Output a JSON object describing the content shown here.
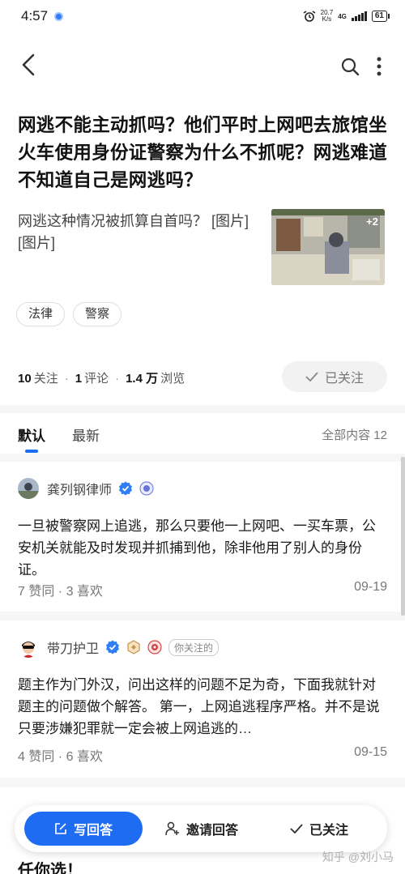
{
  "status_bar": {
    "time": "4:57",
    "speed_value": "20.7",
    "speed_unit": "K/s",
    "network": "4G",
    "battery": "61"
  },
  "question": {
    "title": "网逃不能主动抓吗？他们平时上网吧去旅馆坐火车使用身份证警察为什么不抓呢？网逃难道不知道自己是网逃吗？",
    "detail": "网逃这种情况被抓算自首吗？ [图片] [图片]",
    "image_count": "+2",
    "tags": [
      "法律",
      "警察"
    ],
    "stats": {
      "follow_num": "10",
      "follow_label": "关注",
      "comment_num": "1",
      "comment_label": "评论",
      "view_num": "1.4 万",
      "view_label": "浏览"
    },
    "followed_label": "已关注"
  },
  "tabs": {
    "default": "默认",
    "latest": "最新",
    "total": "全部内容 12"
  },
  "answers": [
    {
      "author": "龚列钢律师",
      "text": "一旦被警察网上追逃，那么只要他一上网吧、一买车票，公安机关就能及时发现并抓捕到他，除非他用了别人的身份证。",
      "meta": "7  赞同 · 3  喜欢",
      "date": "09-19"
    },
    {
      "author": "带刀护卫",
      "follow_tag": "你关注的",
      "text": "题主作为门外汉，问出这样的问题不足为奇，下面我就针对题主的问题做个解答。 第一，上网追逃程序严格。并不是说只要涉嫌犯罪就一定会被上网追逃的…",
      "meta": "4  赞同 · 6  喜欢",
      "date": "09-15"
    }
  ],
  "partial_answer_text": "任你选！",
  "actions": {
    "write": "写回答",
    "invite": "邀请回答",
    "followed": "已关注"
  },
  "watermark": "知乎 @刘小马",
  "colors": {
    "accent": "#1e6cf2",
    "verified": "#2f7ef5"
  }
}
